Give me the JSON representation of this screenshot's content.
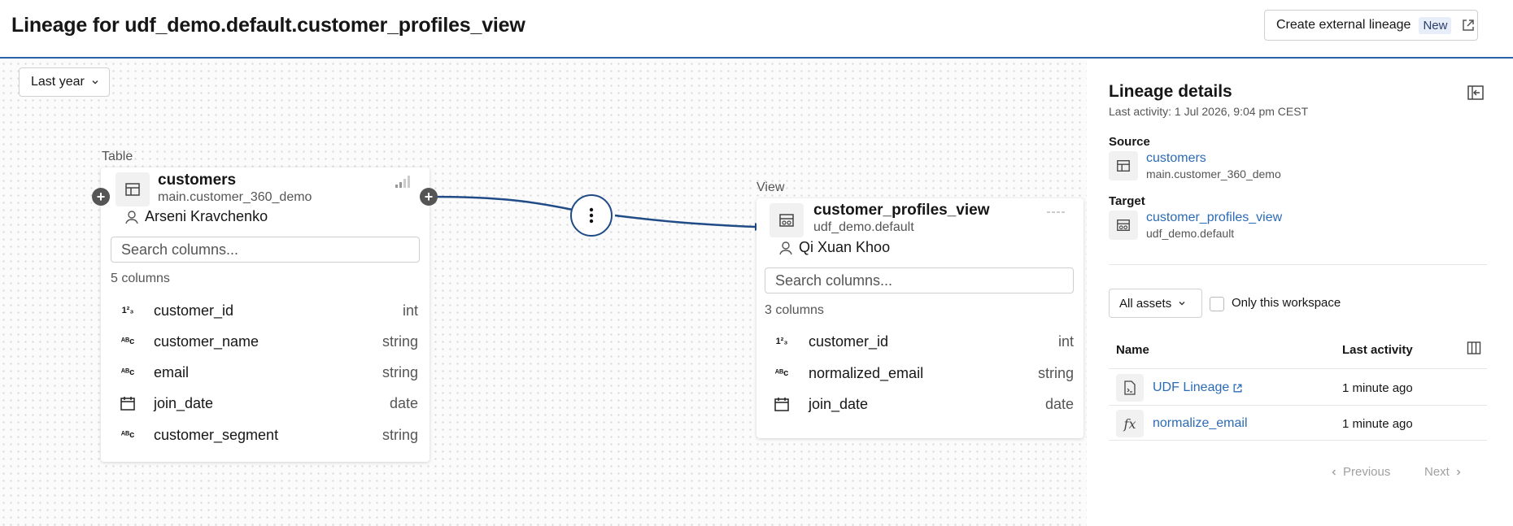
{
  "header": {
    "title": "Lineage for udf_demo.default.customer_profiles_view",
    "ext_button_label": "Create external lineage",
    "ext_button_badge": "New"
  },
  "canvas": {
    "period_label": "Last year",
    "source_node": {
      "type_label": "Table",
      "name": "customers",
      "schema": "main.customer_360_demo",
      "owner": "Arseni Kravchenko",
      "search_placeholder": "Search columns...",
      "column_count": "5 columns",
      "columns": [
        {
          "name": "customer_id",
          "type": "int",
          "icon": "integer-icon"
        },
        {
          "name": "customer_name",
          "type": "string",
          "icon": "string-icon"
        },
        {
          "name": "email",
          "type": "string",
          "icon": "string-icon"
        },
        {
          "name": "join_date",
          "type": "date",
          "icon": "calendar-icon"
        },
        {
          "name": "customer_segment",
          "type": "string",
          "icon": "string-icon"
        }
      ]
    },
    "target_node": {
      "type_label": "View",
      "name": "customer_profiles_view",
      "schema": "udf_demo.default",
      "owner": "Qi Xuan Khoo",
      "search_placeholder": "Search columns...",
      "column_count": "3 columns",
      "columns": [
        {
          "name": "customer_id",
          "type": "int",
          "icon": "integer-icon"
        },
        {
          "name": "normalized_email",
          "type": "string",
          "icon": "string-icon"
        },
        {
          "name": "join_date",
          "type": "date",
          "icon": "calendar-icon"
        }
      ]
    },
    "edge_color": "#1f4b86"
  },
  "panel": {
    "title": "Lineage details",
    "last_activity": "Last activity: 1 Jul 2026, 9:04 pm CEST",
    "source_label": "Source",
    "source_name": "customers",
    "source_schema": "main.customer_360_demo",
    "target_label": "Target",
    "target_name": "customer_profiles_view",
    "target_schema": "udf_demo.default",
    "assets_filter": "All assets",
    "workspace_checkbox_label": "Only this workspace",
    "table": {
      "col_name": "Name",
      "col_activity": "Last activity",
      "rows": [
        {
          "name": "UDF Lineage",
          "time": "1 minute ago",
          "icon": "notebook-icon"
        },
        {
          "name": "normalize_email",
          "time": "1 minute ago",
          "icon": "function-icon"
        }
      ]
    },
    "pager_prev": "Previous",
    "pager_next": "Next"
  },
  "colors": {
    "accent": "#2a63a6",
    "link": "#2b6bb5"
  }
}
